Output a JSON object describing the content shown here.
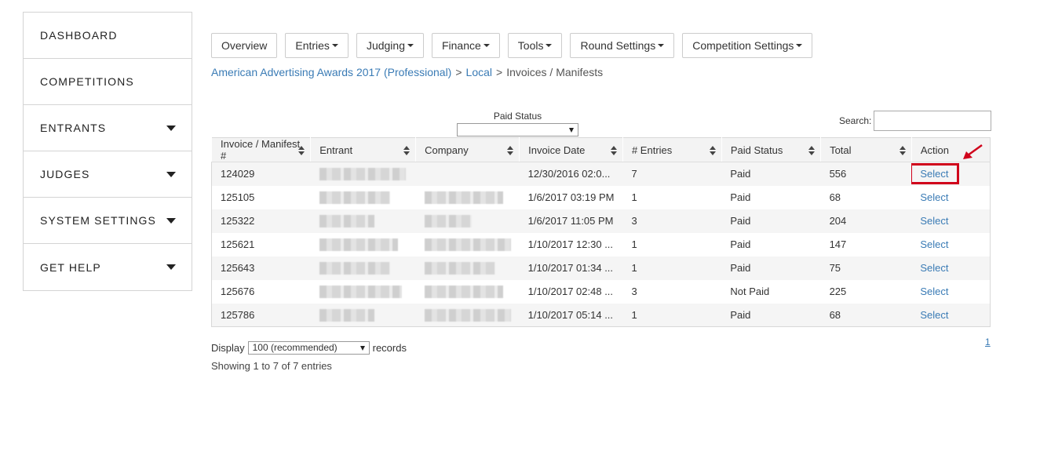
{
  "sidebar": {
    "items": [
      {
        "label": "DASHBOARD",
        "has_caret": false
      },
      {
        "label": "COMPETITIONS",
        "has_caret": false
      },
      {
        "label": "ENTRANTS",
        "has_caret": true
      },
      {
        "label": "JUDGES",
        "has_caret": true
      },
      {
        "label": "SYSTEM SETTINGS",
        "has_caret": true
      },
      {
        "label": "GET HELP",
        "has_caret": true
      }
    ]
  },
  "topnav": {
    "buttons": [
      {
        "label": "Overview",
        "dropdown": false
      },
      {
        "label": "Entries",
        "dropdown": true
      },
      {
        "label": "Judging",
        "dropdown": true
      },
      {
        "label": "Finance",
        "dropdown": true
      },
      {
        "label": "Tools",
        "dropdown": true
      },
      {
        "label": "Round Settings",
        "dropdown": true
      },
      {
        "label": "Competition Settings",
        "dropdown": true
      }
    ]
  },
  "breadcrumb": {
    "competition": "American Advertising Awards 2017 (Professional)",
    "sep": ">",
    "level": "Local",
    "current": "Invoices / Manifests"
  },
  "filter": {
    "paid_status_label": "Paid Status",
    "paid_status_value": ""
  },
  "search": {
    "label": "Search:",
    "value": ""
  },
  "table": {
    "columns": [
      "Invoice / Manifest #",
      "Entrant",
      "Company",
      "Invoice Date",
      "# Entries",
      "Paid Status",
      "Total",
      "Action"
    ],
    "rows": [
      {
        "invoice": "124029",
        "invoice_date": "12/30/2016 02:0...",
        "entries": "7",
        "paid_status": "Paid",
        "total": "556",
        "action": "Select"
      },
      {
        "invoice": "125105",
        "invoice_date": "1/6/2017 03:19 PM",
        "entries": "1",
        "paid_status": "Paid",
        "total": "68",
        "action": "Select"
      },
      {
        "invoice": "125322",
        "invoice_date": "1/6/2017 11:05 PM",
        "entries": "3",
        "paid_status": "Paid",
        "total": "204",
        "action": "Select"
      },
      {
        "invoice": "125621",
        "invoice_date": "1/10/2017 12:30 ...",
        "entries": "1",
        "paid_status": "Paid",
        "total": "147",
        "action": "Select"
      },
      {
        "invoice": "125643",
        "invoice_date": "1/10/2017 01:34 ...",
        "entries": "1",
        "paid_status": "Paid",
        "total": "75",
        "action": "Select"
      },
      {
        "invoice": "125676",
        "invoice_date": "1/10/2017 02:48 ...",
        "entries": "3",
        "paid_status": "Not Paid",
        "total": "225",
        "action": "Select"
      },
      {
        "invoice": "125786",
        "invoice_date": "1/10/2017 05:14 ...",
        "entries": "1",
        "paid_status": "Paid",
        "total": "68",
        "action": "Select"
      }
    ]
  },
  "footer": {
    "display_label": "Display",
    "display_value": "100 (recommended)",
    "records_label": "records",
    "showing": "Showing 1 to 7 of 7 entries",
    "page": "1"
  },
  "colors": {
    "link": "#3a7bb5",
    "highlight": "#d0021b"
  }
}
